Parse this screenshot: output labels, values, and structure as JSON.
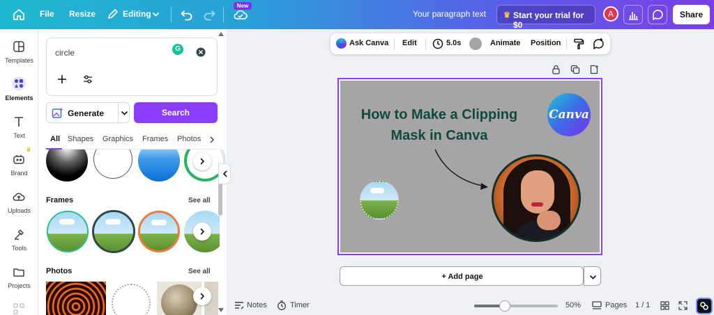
{
  "topbar": {
    "menu_file": "File",
    "menu_resize": "Resize",
    "mode": "Editing",
    "new_badge": "New",
    "doc_title": "Your paragraph text",
    "trial_label": "Start your trial for $0",
    "avatar_initial": "A",
    "share_label": "Share"
  },
  "rail": {
    "items": [
      {
        "label": "Templates",
        "icon": "templates-icon"
      },
      {
        "label": "Elements",
        "icon": "elements-icon"
      },
      {
        "label": "Text",
        "icon": "text-icon"
      },
      {
        "label": "Brand",
        "icon": "brand-icon"
      },
      {
        "label": "Uploads",
        "icon": "uploads-icon"
      },
      {
        "label": "Tools",
        "icon": "tools-icon"
      },
      {
        "label": "Projects",
        "icon": "projects-icon"
      }
    ]
  },
  "panel": {
    "search_value": "circle",
    "grammarly_letter": "G",
    "generate_label": "Generate",
    "search_button": "Search",
    "tabs": [
      "All",
      "Shapes",
      "Graphics",
      "Frames",
      "Photos"
    ],
    "active_tab": "All",
    "frames_heading": "Frames",
    "photos_heading": "Photos",
    "see_all": "See all"
  },
  "context_toolbar": {
    "ask_canva": "Ask Canva",
    "edit": "Edit",
    "duration": "5.0s",
    "animate": "Animate",
    "position": "Position"
  },
  "design": {
    "title_line1": "How to Make a Clipping",
    "title_line2": "Mask in Canva",
    "logo_text": "Canva"
  },
  "canvas": {
    "add_page": "+ Add page"
  },
  "bottombar": {
    "notes": "Notes",
    "timer": "Timer",
    "zoom": "50%",
    "zoom_fraction": 0.37,
    "pages_label": "Pages",
    "page_count": "1 / 1"
  },
  "colors": {
    "accent": "#8b3dff",
    "title_green": "#0f4a3c",
    "design_bg": "#a7a4a6"
  }
}
